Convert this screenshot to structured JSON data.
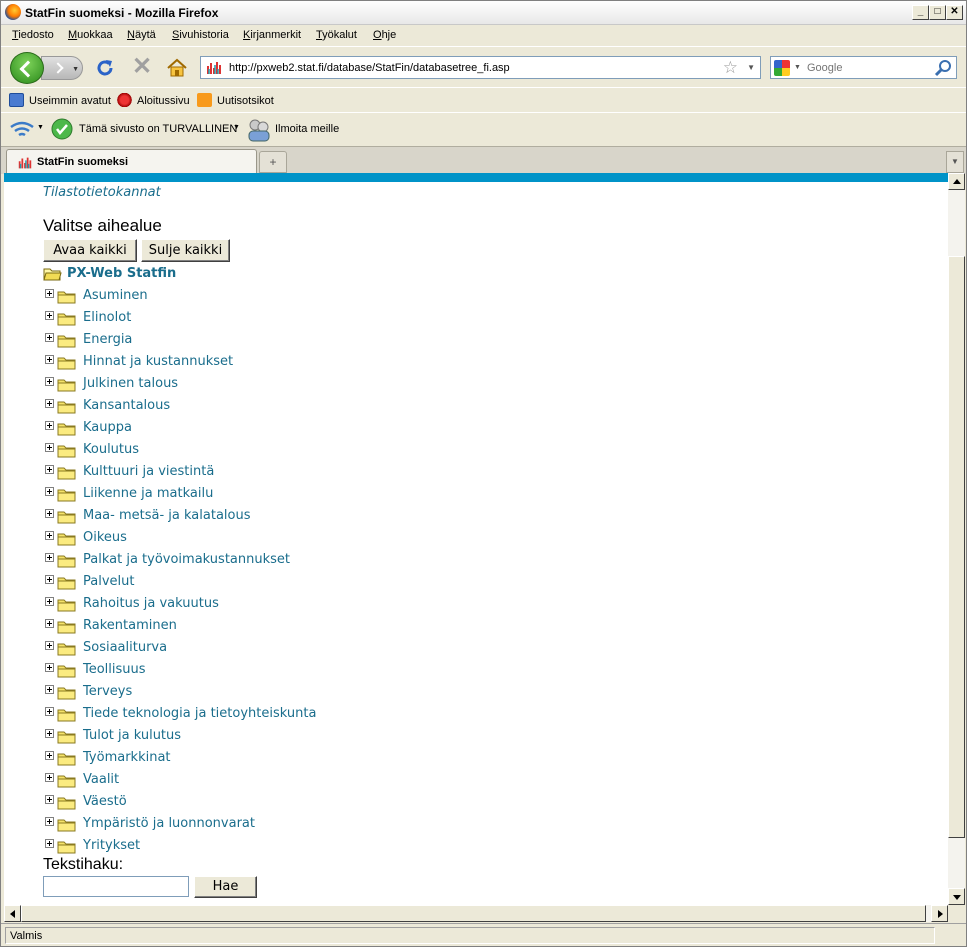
{
  "window": {
    "title": "StatFin suomeksi - Mozilla Firefox"
  },
  "menu": [
    "Tiedosto",
    "Muokkaa",
    "Näytä",
    "Sivuhistoria",
    "Kirjanmerkit",
    "Työkalut",
    "Ohje"
  ],
  "menu_mnemonics": [
    "T",
    "M",
    "N",
    "S",
    "K",
    "T",
    "O"
  ],
  "nav": {
    "url": "http://pxweb2.stat.fi/database/StatFin/databasetree_fi.asp",
    "search_placeholder": "Google"
  },
  "bookmarks": [
    "Useimmin avatut",
    "Aloitussivu",
    "Uutisotsikot"
  ],
  "toolbar2": {
    "safe_text": "Tämä sivusto on TURVALLINEN",
    "report_text": "Ilmoita meille"
  },
  "tab": {
    "label": "StatFin suomeksi"
  },
  "page": {
    "breadcrumb": "Tilastotietokannat",
    "heading": "Valitse aihealue",
    "open_all": "Avaa kaikki",
    "close_all": "Sulje kaikki",
    "root_label": "PX-Web Statfin",
    "topics": [
      "Asuminen",
      "Elinolot",
      "Energia",
      "Hinnat ja kustannukset",
      "Julkinen talous",
      "Kansantalous",
      "Kauppa",
      "Koulutus",
      "Kulttuuri ja viestintä",
      "Liikenne ja matkailu",
      "Maa- metsä- ja kalatalous",
      "Oikeus",
      "Palkat ja työvoimakustannukset",
      "Palvelut",
      "Rahoitus ja vakuutus",
      "Rakentaminen",
      "Sosiaaliturva",
      "Teollisuus",
      "Terveys",
      "Tiede teknologia ja tietoyhteiskunta",
      "Tulot ja kulutus",
      "Työmarkkinat",
      "Vaalit",
      "Väestö",
      "Ympäristö ja luonnonvarat",
      "Yritykset"
    ],
    "search_label": "Tekstihaku:",
    "search_button": "Hae"
  },
  "status": {
    "text": "Valmis"
  },
  "colors": {
    "link": "#1a6d8c",
    "top_band": "#0093c8"
  }
}
